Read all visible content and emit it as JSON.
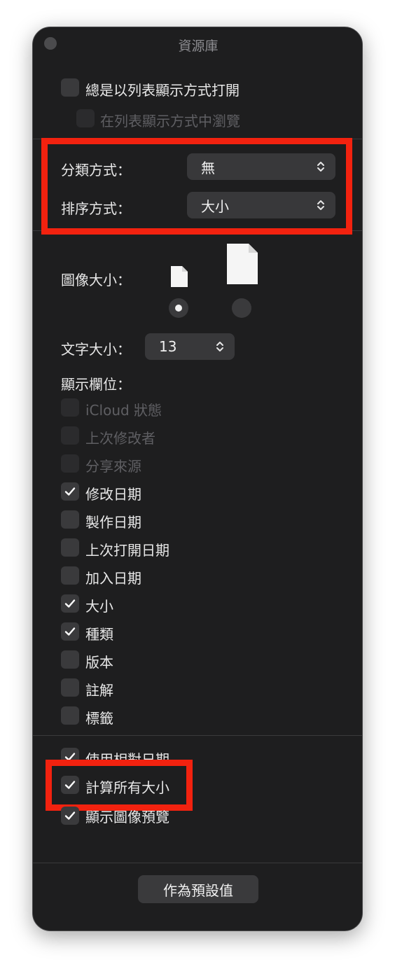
{
  "window": {
    "title": "資源庫"
  },
  "options": {
    "always_list": {
      "label": "總是以列表顯示方式打開",
      "checked": false
    },
    "browse_list": {
      "label": "在列表顯示方式中瀏覽",
      "checked": false,
      "disabled": true
    }
  },
  "grouping": {
    "group_label": "分類方式：",
    "group_value": "無",
    "sort_label": "排序方式：",
    "sort_value": "大小"
  },
  "icon_size": {
    "label": "圖像大小：",
    "selected": "small"
  },
  "text_size": {
    "label": "文字大小：",
    "value": "13"
  },
  "columns": {
    "label": "顯示欄位：",
    "items": [
      {
        "label": "iCloud 狀態",
        "checked": false,
        "disabled": true
      },
      {
        "label": "上次修改者",
        "checked": false,
        "disabled": true
      },
      {
        "label": "分享來源",
        "checked": false,
        "disabled": true
      },
      {
        "label": "修改日期",
        "checked": true,
        "disabled": false
      },
      {
        "label": "製作日期",
        "checked": false,
        "disabled": false
      },
      {
        "label": "上次打開日期",
        "checked": false,
        "disabled": false
      },
      {
        "label": "加入日期",
        "checked": false,
        "disabled": false
      },
      {
        "label": "大小",
        "checked": true,
        "disabled": false
      },
      {
        "label": "種類",
        "checked": true,
        "disabled": false
      },
      {
        "label": "版本",
        "checked": false,
        "disabled": false
      },
      {
        "label": "註解",
        "checked": false,
        "disabled": false
      },
      {
        "label": "標籤",
        "checked": false,
        "disabled": false
      }
    ]
  },
  "extras": {
    "relative_dates": {
      "label": "使用相對日期",
      "checked": true
    },
    "calc_sizes": {
      "label": "計算所有大小",
      "checked": true
    },
    "icon_preview": {
      "label": "顯示圖像預覽",
      "checked": true
    }
  },
  "footer": {
    "default_button": "作為預設值"
  },
  "colors": {
    "window_bg": "#1e1e1f",
    "control_bg": "#3a3a3c",
    "highlight": "#f2220f"
  }
}
